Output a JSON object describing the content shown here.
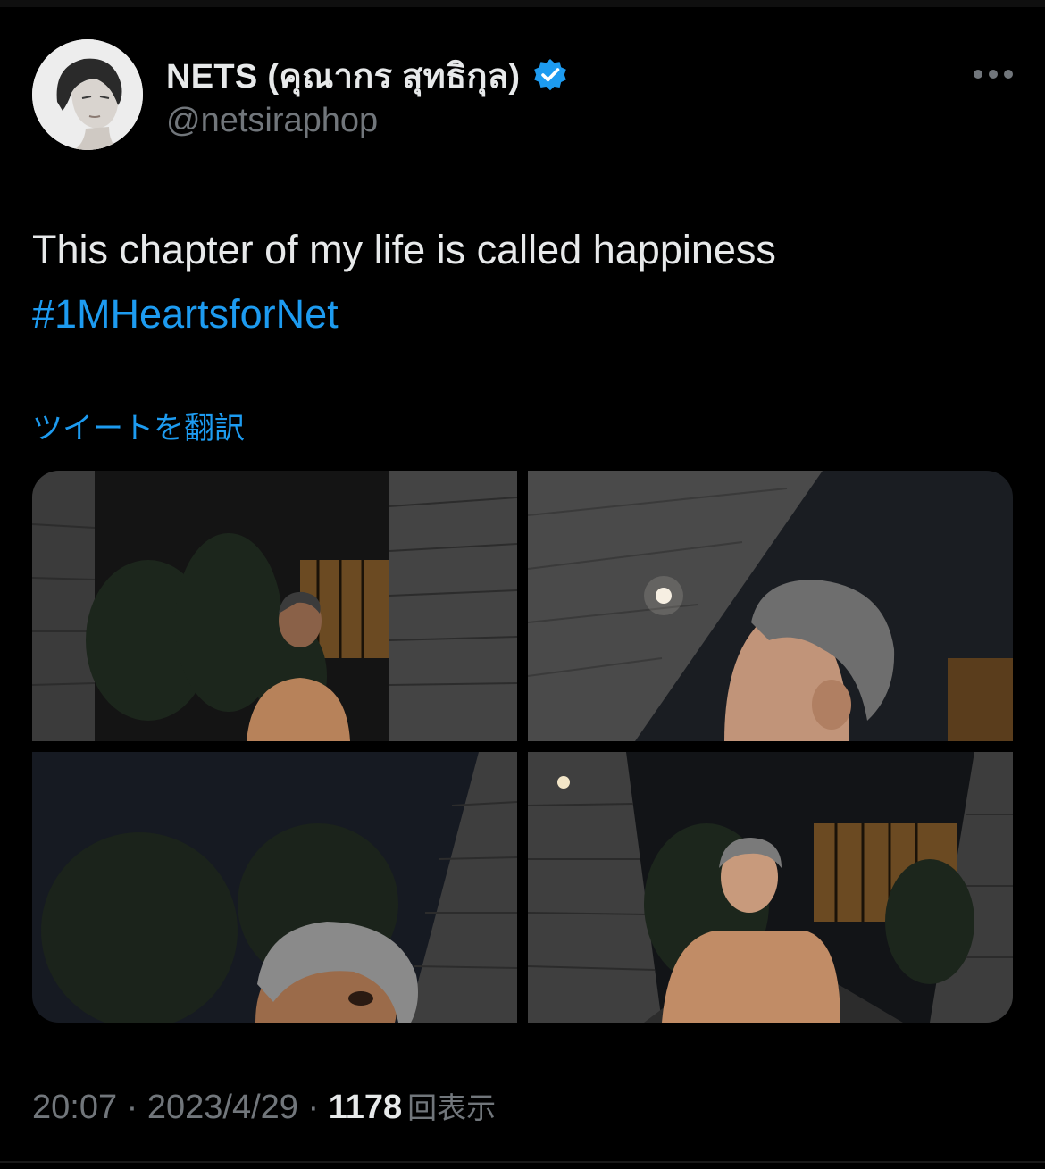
{
  "tweet": {
    "author": {
      "display_name": "NETS (คุณากร สุทธิกุล)",
      "handle": "@netsiraphop",
      "verified": true
    },
    "text": "This chapter of my life is called happiness",
    "hashtag": "#1MHeartsforNet",
    "translate_label": "ツイートを翻訳",
    "meta": {
      "time": "20:07",
      "separator": " · ",
      "date": "2023/4/29",
      "views_count": "1178",
      "views_label": "回表示"
    },
    "photos": [
      {
        "subject": "person-by-brick-wall-night"
      },
      {
        "subject": "person-looking-up-night"
      },
      {
        "subject": "person-closeup-night"
      },
      {
        "subject": "person-seated-night"
      }
    ]
  },
  "colors": {
    "background": "#000000",
    "text": "#e7e9ea",
    "muted": "#71767b",
    "accent": "#1d9bf0"
  },
  "icons": {
    "verified": "verified-badge-icon",
    "more": "more-horizontal-icon"
  }
}
